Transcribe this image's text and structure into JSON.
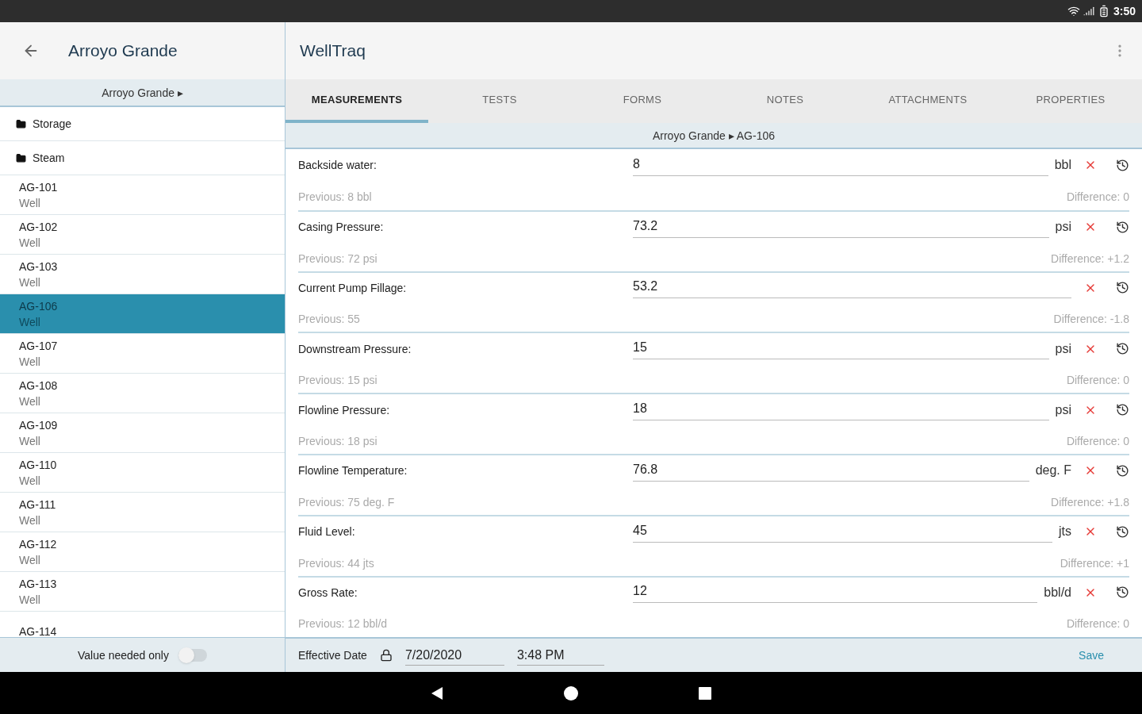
{
  "status_bar": {
    "time": "3:50"
  },
  "left_header": {
    "title": "Arroyo Grande"
  },
  "app_header": {
    "title": "WellTraq"
  },
  "left_breadcrumb": "Arroyo Grande ▸",
  "folders": [
    {
      "label": "Storage"
    },
    {
      "label": "Steam"
    }
  ],
  "wells": [
    {
      "name": "AG-101",
      "type": "Well",
      "selected": false
    },
    {
      "name": "AG-102",
      "type": "Well",
      "selected": false
    },
    {
      "name": "AG-103",
      "type": "Well",
      "selected": false
    },
    {
      "name": "AG-106",
      "type": "Well",
      "selected": true
    },
    {
      "name": "AG-107",
      "type": "Well",
      "selected": false
    },
    {
      "name": "AG-108",
      "type": "Well",
      "selected": false
    },
    {
      "name": "AG-109",
      "type": "Well",
      "selected": false
    },
    {
      "name": "AG-110",
      "type": "Well",
      "selected": false
    },
    {
      "name": "AG-111",
      "type": "Well",
      "selected": false
    },
    {
      "name": "AG-112",
      "type": "Well",
      "selected": false
    },
    {
      "name": "AG-113",
      "type": "Well",
      "selected": false
    },
    {
      "name": "AG-114",
      "selected": false
    }
  ],
  "value_needed_toggle": {
    "label": "Value needed only",
    "on": false
  },
  "tabs": [
    {
      "label": "MEASUREMENTS",
      "selected": true
    },
    {
      "label": "TESTS",
      "selected": false
    },
    {
      "label": "FORMS",
      "selected": false
    },
    {
      "label": "NOTES",
      "selected": false
    },
    {
      "label": "ATTACHMENTS",
      "selected": false
    },
    {
      "label": "PROPERTIES",
      "selected": false
    }
  ],
  "breadcrumb": "Arroyo Grande ▸ AG-106",
  "measurements": [
    {
      "label": "Backside water:",
      "value": "8",
      "unit": "bbl",
      "previous": "Previous: 8 bbl",
      "difference": "Difference: 0"
    },
    {
      "label": "Casing Pressure:",
      "value": "73.2",
      "unit": "psi",
      "previous": "Previous: 72 psi",
      "difference": "Difference: +1.2"
    },
    {
      "label": "Current Pump Fillage:",
      "value": "53.2",
      "previous": "Previous: 55",
      "difference": "Difference: -1.8"
    },
    {
      "label": "Downstream Pressure:",
      "value": "15",
      "unit": "psi",
      "previous": "Previous: 15 psi",
      "difference": "Difference: 0"
    },
    {
      "label": "Flowline Pressure:",
      "value": "18",
      "unit": "psi",
      "previous": "Previous: 18 psi",
      "difference": "Difference: 0"
    },
    {
      "label": "Flowline Temperature:",
      "value": "76.8",
      "unit": "deg. F",
      "previous": "Previous: 75 deg. F",
      "difference": "Difference: +1.8"
    },
    {
      "label": "Fluid Level:",
      "value": "45",
      "unit": "jts",
      "previous": "Previous: 44 jts",
      "difference": "Difference: +1"
    },
    {
      "label": "Gross Rate:",
      "value": "12",
      "unit": "bbl/d",
      "previous": "Previous: 12 bbl/d",
      "difference": "Difference: 0"
    }
  ],
  "footer": {
    "label": "Effective Date",
    "date": "7/20/2020",
    "time": "3:48 PM",
    "save": "Save"
  }
}
